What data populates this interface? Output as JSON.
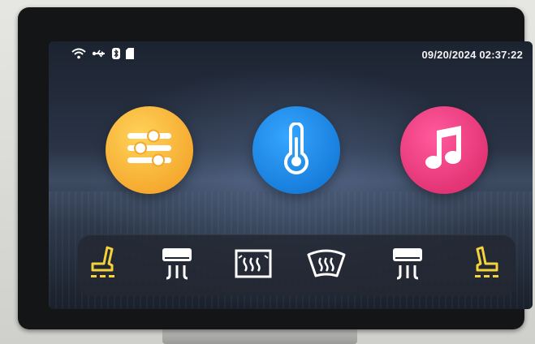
{
  "status": {
    "datetime": "09/20/2024 02:37:22",
    "icons": [
      "wifi-icon",
      "usb-icon",
      "bluetooth-icon",
      "sd-card-icon"
    ]
  },
  "apps": [
    {
      "name": "settings",
      "icon": "sliders-icon",
      "color": "#f4a52a"
    },
    {
      "name": "climate",
      "icon": "thermometer-icon",
      "color": "#1479d8"
    },
    {
      "name": "music",
      "icon": "music-note-icon",
      "color": "#e0306f"
    }
  ],
  "dock": [
    {
      "name": "seat-heat-left",
      "icon": "seat-left-icon",
      "color": "#f5d23a"
    },
    {
      "name": "ac-left",
      "icon": "ac-vent-icon",
      "color": "#ffffff"
    },
    {
      "name": "rear-defrost",
      "icon": "rear-defrost-icon",
      "color": "#ffffff"
    },
    {
      "name": "front-defrost",
      "icon": "front-defrost-icon",
      "color": "#ffffff"
    },
    {
      "name": "ac-right",
      "icon": "ac-vent-icon",
      "color": "#ffffff"
    },
    {
      "name": "seat-heat-right",
      "icon": "seat-right-icon",
      "color": "#f5d23a"
    }
  ]
}
